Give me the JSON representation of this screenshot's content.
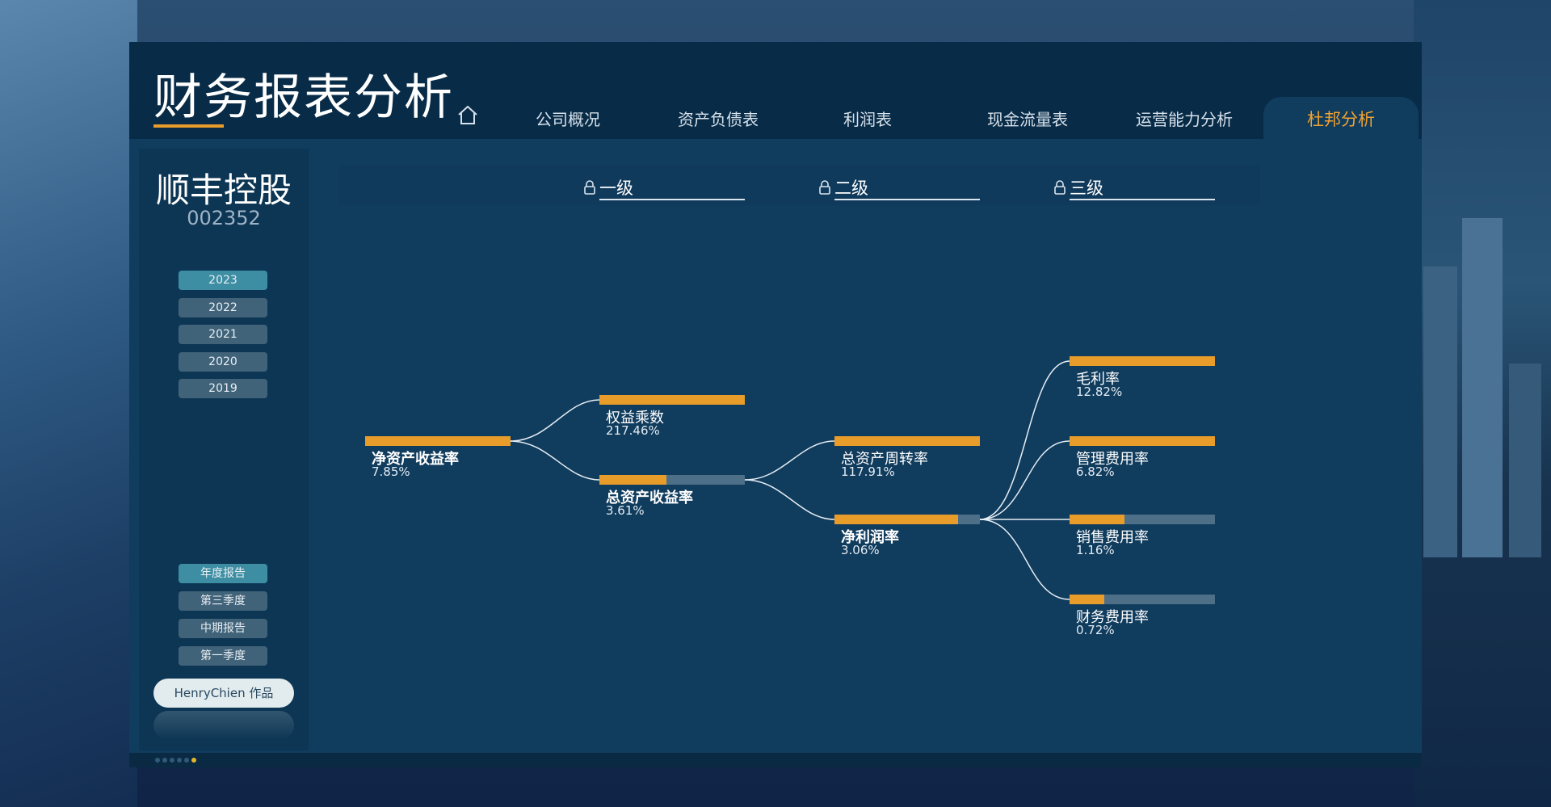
{
  "header": {
    "title": "财务报表分析",
    "nav": [
      "公司概况",
      "资产负债表",
      "利润表",
      "现金流量表",
      "运营能力分析"
    ],
    "nav_active": "杜邦分析"
  },
  "company": {
    "name": "顺丰控股",
    "code": "002352"
  },
  "years": [
    "2023",
    "2022",
    "2021",
    "2020",
    "2019"
  ],
  "active_year": "2023",
  "reports": [
    "年度报告",
    "第三季度",
    "中期报告",
    "第一季度"
  ],
  "active_report": "年度报告",
  "author": "HenryChien 作品",
  "levels": [
    "一级",
    "二级",
    "三级"
  ],
  "dupont": {
    "roe": {
      "label": "净资产收益率",
      "value": "7.85%",
      "fill": 1.0
    },
    "equity_multiplier": {
      "label": "权益乘数",
      "value": "217.46%",
      "fill": 1.0
    },
    "roa": {
      "label": "总资产收益率",
      "value": "3.61%",
      "fill": 0.46
    },
    "asset_turnover": {
      "label": "总资产周转率",
      "value": "117.91%",
      "fill": 1.0
    },
    "net_margin": {
      "label": "净利润率",
      "value": "3.06%",
      "fill": 0.85
    },
    "gross_margin": {
      "label": "毛利率",
      "value": "12.82%",
      "fill": 1.0
    },
    "admin_expense_rate": {
      "label": "管理费用率",
      "value": "6.82%",
      "fill": 1.0
    },
    "selling_expense_rate": {
      "label": "销售费用率",
      "value": "1.16%",
      "fill": 0.38
    },
    "finance_expense_rate": {
      "label": "财务费用率",
      "value": "0.72%",
      "fill": 0.24
    }
  },
  "colors": {
    "accent": "#e89c2a",
    "panel": "#103c5e",
    "header": "#082b47",
    "track": "#4e6f88"
  },
  "pagination": {
    "total": 6,
    "active": 6
  }
}
